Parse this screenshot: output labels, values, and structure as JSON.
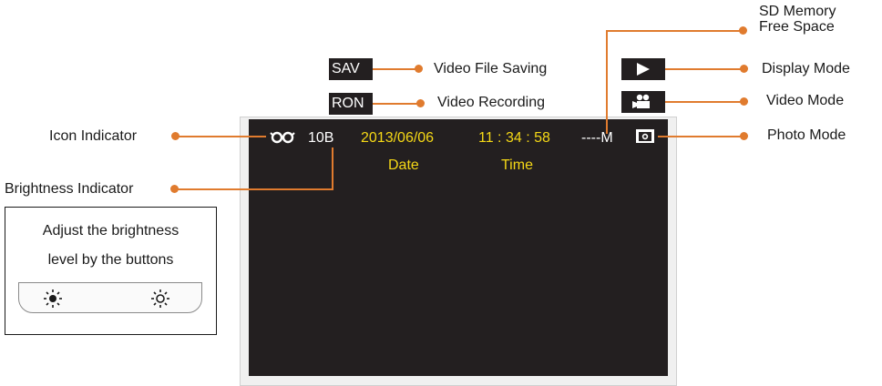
{
  "labels": {
    "icon_indicator": "Icon Indicator",
    "brightness_indicator": "Brightness Indicator",
    "video_file_saving": "Video File Saving",
    "video_recording": "Video Recording",
    "sd_memory_line1": "SD Memory",
    "sd_memory_line2": "Free Space",
    "display_mode": "Display Mode",
    "video_mode": "Video Mode",
    "photo_mode": "Photo Mode"
  },
  "tags": {
    "sav": "SAV",
    "ron": "RON"
  },
  "screen": {
    "brightness_value": "10B",
    "date_value": "2013/06/06",
    "time_value": "11 : 34 : 58",
    "free_space_value": "----M",
    "date_caption": "Date",
    "time_caption": "Time"
  },
  "brightness_box": {
    "line1": "Adjust the brightness",
    "line2": "level by the buttons"
  },
  "colors": {
    "callout": "#e07b2e",
    "screen_text_highlight": "#f5d816",
    "screen_background": "#231f20"
  },
  "icons": [
    "glasses-icon",
    "play-icon",
    "video-camera-icon",
    "camera-icon",
    "sun-dark-icon",
    "sun-light-icon"
  ]
}
